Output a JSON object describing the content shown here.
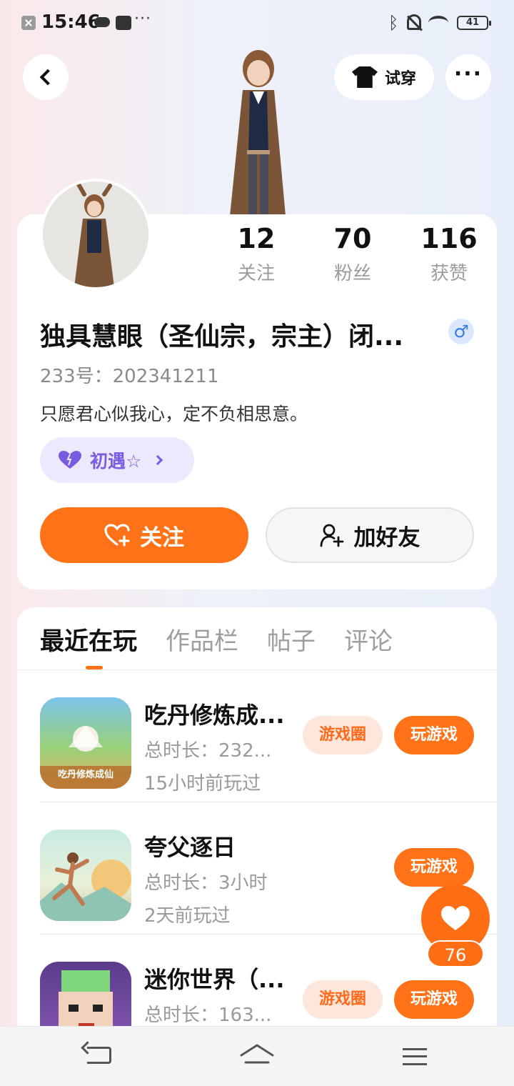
{
  "status_bar": {
    "time": "15:46",
    "battery": "41"
  },
  "header": {
    "tryon_label": "试穿"
  },
  "profile": {
    "stats": [
      {
        "value": "12",
        "label": "关注"
      },
      {
        "value": "70",
        "label": "粉丝"
      },
      {
        "value": "116",
        "label": "获赞"
      }
    ],
    "name": "独具慧眼（圣仙宗，宗主）闭...",
    "gender_symbol": "♂",
    "uid": "233号：202341211",
    "bio": "只愿君心似我心，定不负相思意。",
    "tag": "初遇☆",
    "follow_label": "关注",
    "add_friend_label": "加好友"
  },
  "tabs": [
    {
      "label": "最近在玩",
      "active": true
    },
    {
      "label": "作品栏",
      "active": false
    },
    {
      "label": "帖子",
      "active": false
    },
    {
      "label": "评论",
      "active": false
    }
  ],
  "games": [
    {
      "name": "吃丹修炼成...",
      "thumb_text": "吃丹修炼成仙",
      "duration": "总时长：232...",
      "last_played": "15小时前玩过",
      "circle_label": "游戏圈",
      "play_label": "玩游戏"
    },
    {
      "name": "夸父逐日",
      "duration": "总时长：3小时",
      "last_played": "2天前玩过",
      "play_label": "玩游戏"
    },
    {
      "name": "迷你世界（...",
      "duration": "总时长：163...",
      "circle_label": "游戏圈",
      "play_label": "玩游戏"
    }
  ],
  "like_fab": {
    "count": "76"
  },
  "colors": {
    "accent": "#ff7217",
    "tag_purple": "#7a5ce0"
  }
}
